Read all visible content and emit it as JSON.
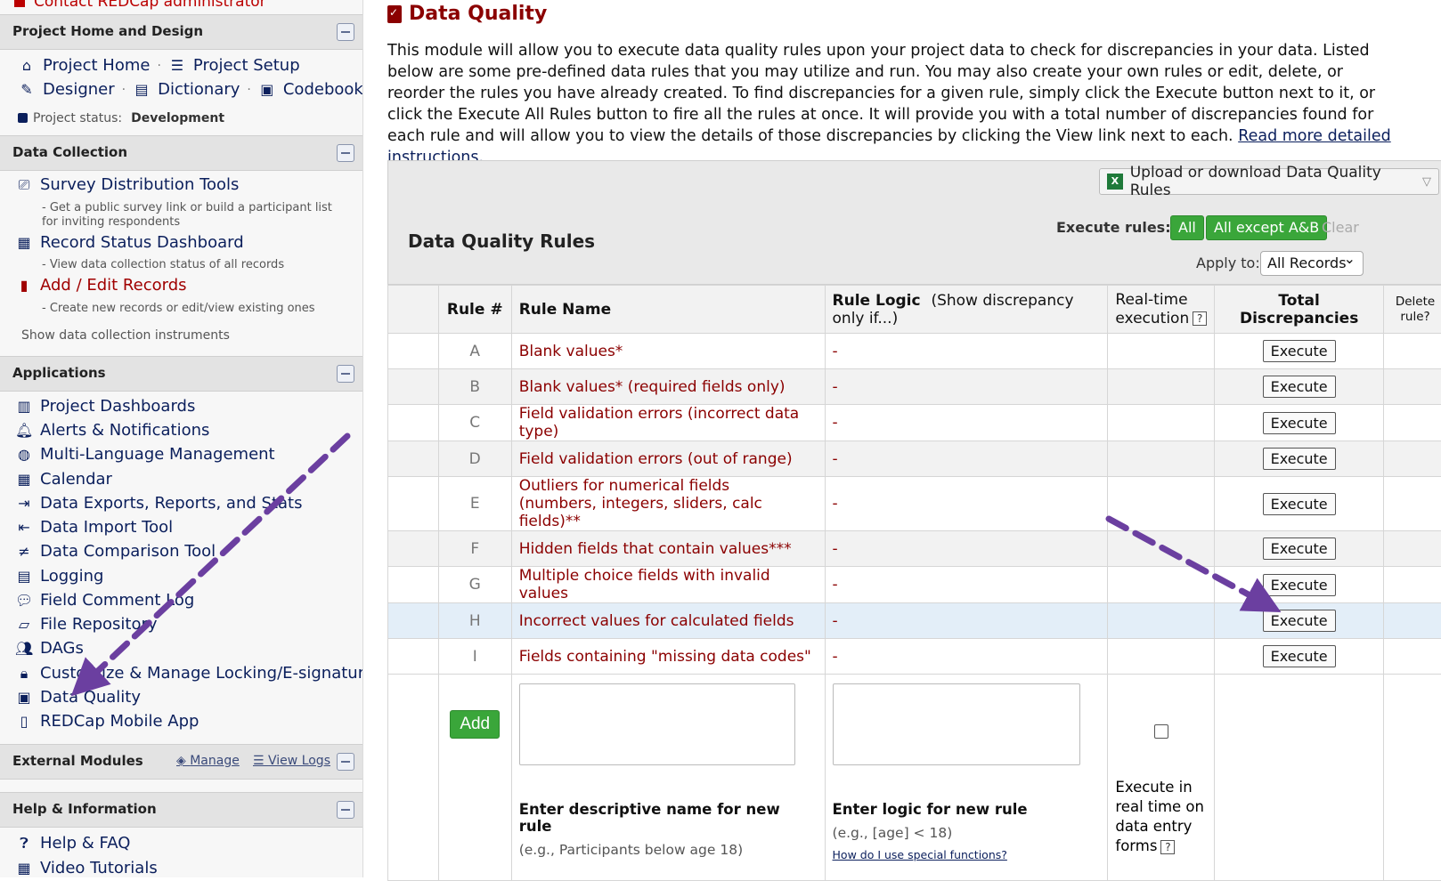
{
  "sidebar": {
    "contact": "Contact REDCap administrator",
    "project_home_design": {
      "header": "Project Home and Design",
      "project_home": "Project Home",
      "project_setup": "Project Setup",
      "designer": "Designer",
      "dictionary": "Dictionary",
      "codebook": "Codebook",
      "status_label": "Project status:",
      "status_value": "Development"
    },
    "data_collection": {
      "header": "Data Collection",
      "survey_tools": "Survey Distribution Tools",
      "survey_tools_desc": "- Get a public survey link or build a participant list for inviting respondents",
      "record_status": "Record Status Dashboard",
      "record_status_desc": "- View data collection status of all records",
      "add_edit": "Add / Edit Records",
      "add_edit_desc": "- Create new records or edit/view existing ones",
      "show_instruments": "Show data collection instruments"
    },
    "applications": {
      "header": "Applications",
      "items": [
        "Project Dashboards",
        "Alerts & Notifications",
        "Multi-Language Management",
        "Calendar",
        "Data Exports, Reports, and Stats",
        "Data Import Tool",
        "Data Comparison Tool",
        "Logging",
        "Field Comment Log",
        "File Repository",
        "DAGs",
        "Customize & Manage Locking/E-signatures",
        "Data Quality",
        "REDCap Mobile App"
      ]
    },
    "external_modules": {
      "header": "External Modules",
      "manage": "Manage",
      "view_logs": "View Logs"
    },
    "help": {
      "header": "Help & Information",
      "faq": "Help & FAQ",
      "videos": "Video Tutorials"
    }
  },
  "main": {
    "title": "Data Quality",
    "intro": "This module will allow you to execute data quality rules upon your project data to check for discrepancies in your data. Listed below are some pre-defined data rules that you may utilize and run. You may also create your own rules or edit, delete, or reorder the rules you have already created. To find discrepancies for a given rule, simply click the Execute button next to it, or click the Execute All Rules button to fire all the rules at once. It will provide you with a total number of discrepancies found for each rule and will allow you to view the details of those discrepancies by clicking the View link next to each.",
    "instructions_link": "Read more detailed instructions.",
    "panel": {
      "title": "Data Quality Rules",
      "upload_download": "Upload or download Data Quality Rules",
      "execute_rules_label": "Execute rules:",
      "btn_all": "All",
      "btn_all_except": "All except A&B",
      "btn_clear": "Clear",
      "apply_to_label": "Apply to:",
      "apply_to_value": "All Records"
    },
    "table": {
      "headers": {
        "rule_num": "Rule #",
        "rule_name": "Rule Name",
        "rule_logic": "Rule Logic",
        "rule_logic_note": "(Show discrepancy only if...)",
        "realtime": "Real-time execution",
        "total": "Total Discrepancies",
        "delete": "Delete rule?"
      },
      "execute_label": "Execute",
      "rows": [
        {
          "letter": "A",
          "name": "Blank values*",
          "logic": "-"
        },
        {
          "letter": "B",
          "name": "Blank values* (required fields only)",
          "logic": "-"
        },
        {
          "letter": "C",
          "name": "Field validation errors (incorrect data type)",
          "logic": "-"
        },
        {
          "letter": "D",
          "name": "Field validation errors (out of range)",
          "logic": "-"
        },
        {
          "letter": "E",
          "name": "Outliers for numerical fields",
          "name2": "(numbers, integers, sliders, calc fields)**",
          "logic": "-"
        },
        {
          "letter": "F",
          "name": "Hidden fields that contain values***",
          "logic": "-"
        },
        {
          "letter": "G",
          "name": "Multiple choice fields with invalid values",
          "logic": "-"
        },
        {
          "letter": "H",
          "name": "Incorrect values for calculated fields",
          "logic": "-"
        },
        {
          "letter": "I",
          "name": "Fields containing \"missing data codes\"",
          "logic": "-"
        }
      ],
      "new_rule": {
        "add": "Add",
        "name_label": "Enter descriptive name for new rule",
        "name_example": "(e.g., Participants below age 18)",
        "logic_label": "Enter logic for new rule",
        "logic_example": "(e.g., [age] < 18)",
        "howto": "How do I use special functions?",
        "realtime_text": "Execute in real time on data entry forms"
      }
    }
  },
  "colors": {
    "accent_red": "#8b0000",
    "nav_blue": "#0b1f5c",
    "green": "#3aa63a",
    "arrow": "#6b3fa0"
  }
}
